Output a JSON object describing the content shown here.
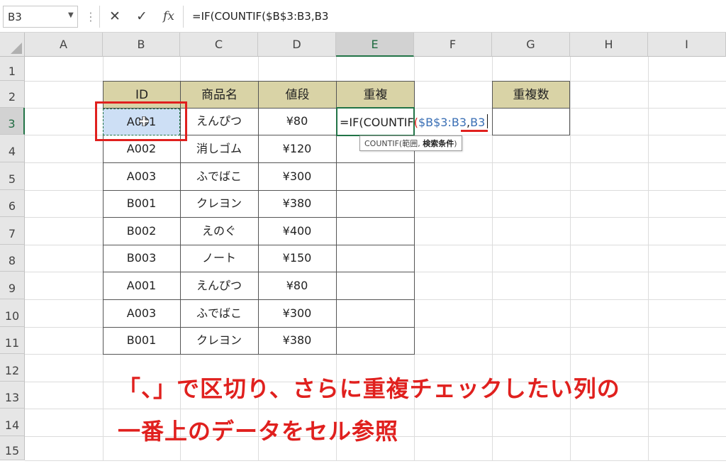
{
  "formula_bar": {
    "name_box": "B3",
    "cancel_icon": "✕",
    "enter_icon": "✓",
    "fx_icon": "fx",
    "formula": "=IF(COUNTIF($B$3:B3,B3"
  },
  "columns": [
    "A",
    "B",
    "C",
    "D",
    "E",
    "F",
    "G",
    "H",
    "I"
  ],
  "rows": [
    "1",
    "2",
    "3",
    "4",
    "5",
    "6",
    "7",
    "8",
    "9",
    "10",
    "11",
    "12",
    "13",
    "14",
    "15"
  ],
  "selected_column": "E",
  "selected_row": "3",
  "table": {
    "headers": [
      "ID",
      "商品名",
      "値段",
      "重複"
    ],
    "rows": [
      [
        "A001",
        "えんぴつ",
        "¥80"
      ],
      [
        "A002",
        "消しゴム",
        "¥120"
      ],
      [
        "A003",
        "ふでばこ",
        "¥300"
      ],
      [
        "B001",
        "クレヨン",
        "¥380"
      ],
      [
        "B002",
        "えのぐ",
        "¥400"
      ],
      [
        "B003",
        "ノート",
        "¥150"
      ],
      [
        "A001",
        "えんぴつ",
        "¥80"
      ],
      [
        "A003",
        "ふでばこ",
        "¥300"
      ],
      [
        "B001",
        "クレヨン",
        "¥380"
      ]
    ]
  },
  "dup_count_header": "重複数",
  "editing": {
    "part1": "=IF(COUNTIF",
    "part2": "(",
    "part3": "$B$3:B3",
    "part4": ",",
    "part5": "B3"
  },
  "tooltip": {
    "func": "COUNTIF(",
    "arg1": "範囲, ",
    "arg2": "検索条件",
    "close": ")"
  },
  "annotation": {
    "line1": "「、」で区切り、さらに重複チェックしたい列の",
    "line2": "一番上のデータをセル参照"
  },
  "colors": {
    "accent_green": "#217346",
    "header_fill": "#d9d3a6",
    "annotation_red": "#e0201e",
    "ref_blue": "#3a6fb5"
  }
}
